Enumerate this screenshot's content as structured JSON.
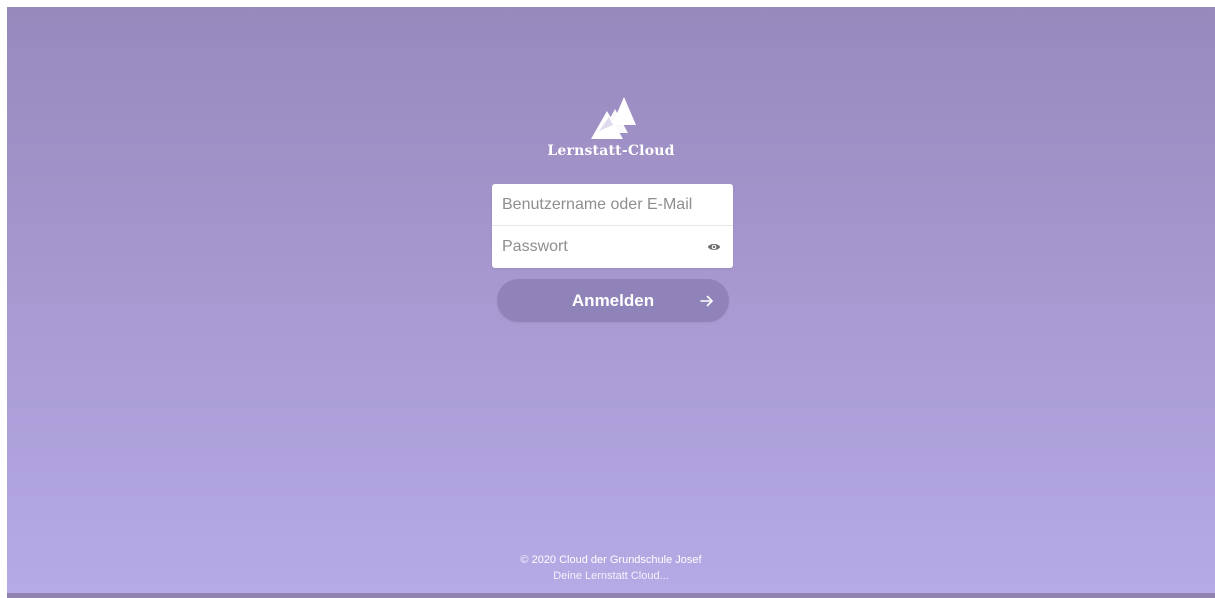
{
  "app": {
    "name": "Lernstatt-Cloud",
    "logo_icon": "mountains-logo-icon"
  },
  "login": {
    "username_placeholder": "Benutzername oder E-Mail",
    "username_value": "",
    "password_placeholder": "Passwort",
    "password_value": "",
    "show_password_icon": "eye-icon",
    "submit_label": "Anmelden",
    "submit_icon": "arrow-right-icon"
  },
  "footer": {
    "copyright_symbol": "©",
    "copyright_link": "2020 Cloud der Grundschule Josef",
    "slogan": "Deine Lernstatt Cloud..."
  },
  "colors": {
    "background_top": "#9789bc",
    "background_bottom": "#b6aae6",
    "button": "#8f83b9"
  }
}
